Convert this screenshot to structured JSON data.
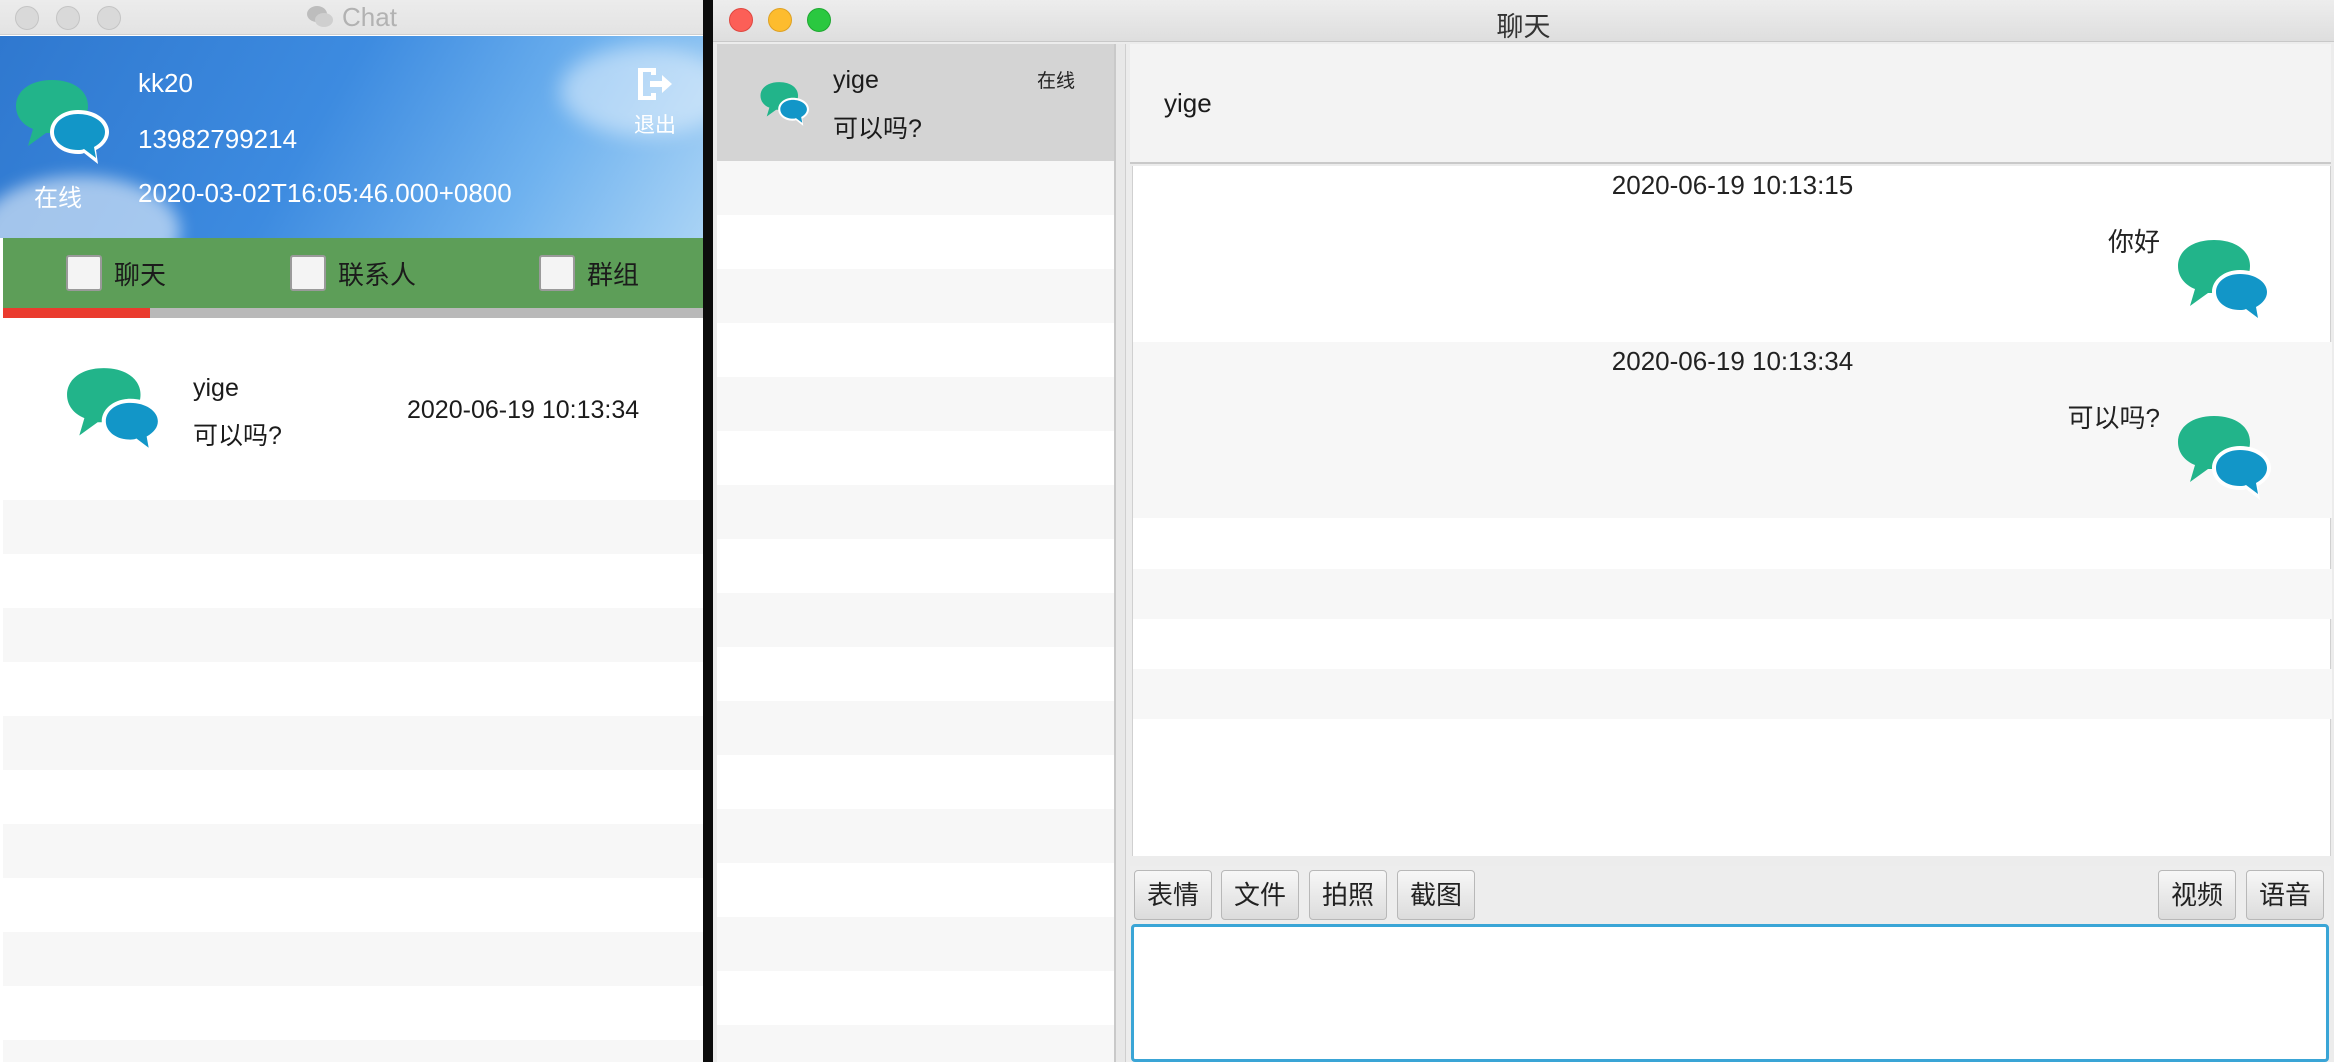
{
  "left_window": {
    "title": "Chat",
    "profile": {
      "username": "kk20",
      "phone": "13982799214",
      "datetime": "2020-03-02T16:05:46.000+0800",
      "status": "在线",
      "logout_label": "退出"
    },
    "tabs": [
      {
        "label": "聊天",
        "checked": false
      },
      {
        "label": "联系人",
        "checked": false
      },
      {
        "label": "群组",
        "checked": false
      }
    ],
    "tab_progress": 0.21,
    "conversations": [
      {
        "name": "yige",
        "last_message": "可以吗?",
        "time": "2020-06-19 10:13:34"
      }
    ]
  },
  "right_window": {
    "title": "聊天",
    "contacts": [
      {
        "name": "yige",
        "status": "在线",
        "last_message": "可以吗?"
      }
    ],
    "chat_header": {
      "name": "yige"
    },
    "messages": [
      {
        "timestamp": "2020-06-19 10:13:15",
        "text": "你好",
        "side": "right"
      },
      {
        "timestamp": "2020-06-19 10:13:34",
        "text": "可以吗?",
        "side": "right"
      }
    ],
    "toolbar": {
      "left_buttons": [
        "表情",
        "文件",
        "拍照",
        "截图"
      ],
      "right_buttons": [
        "视频",
        "语音"
      ]
    },
    "input": {
      "value": ""
    }
  },
  "colors": {
    "profile_blue": "#3d8be0",
    "tab_green": "#5d9e58",
    "progress_red": "#ea3b2e",
    "icon_green": "#22b48a",
    "icon_blue": "#1296c8",
    "input_border": "#3aa5d6"
  },
  "icons": {
    "avatar": "chat-bubbles-icon",
    "logout": "logout-icon"
  }
}
